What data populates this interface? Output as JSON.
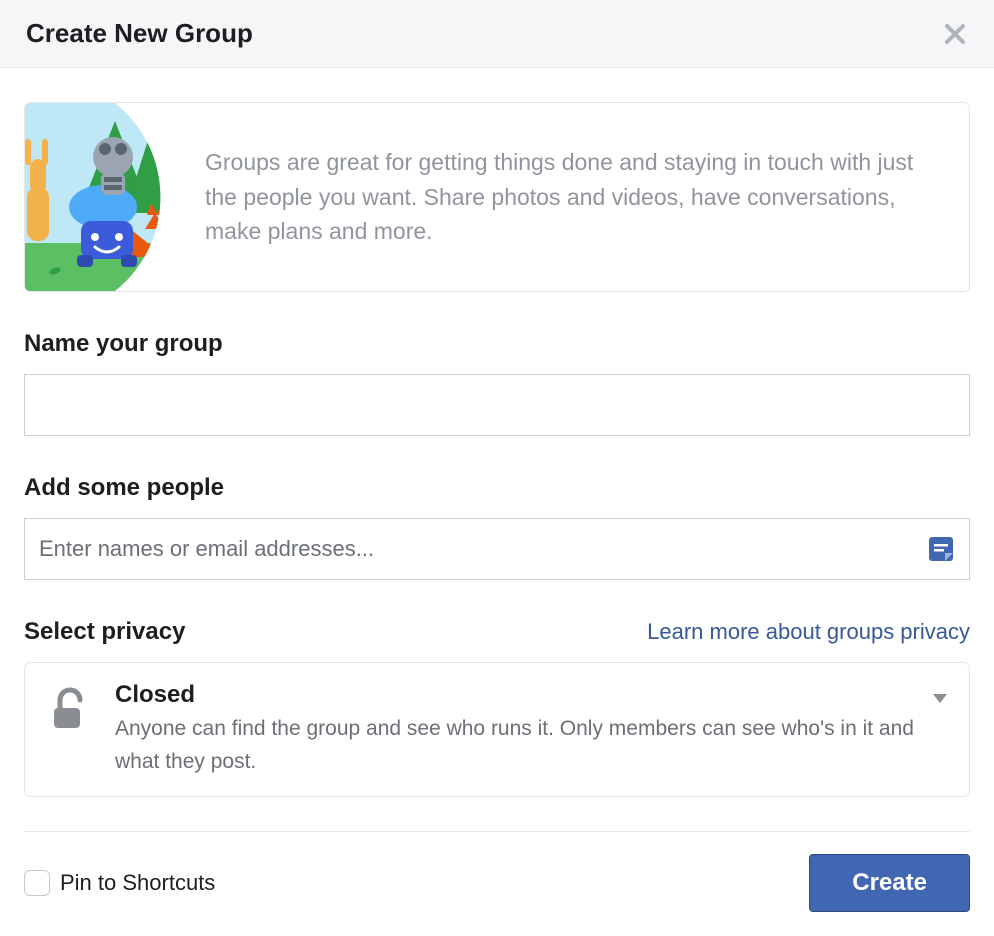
{
  "header": {
    "title": "Create New Group"
  },
  "intro": {
    "text": "Groups are great for getting things done and staying in touch with just the people you want. Share photos and videos, have conversations, make plans and more."
  },
  "name_section": {
    "label": "Name your group",
    "value": ""
  },
  "people_section": {
    "label": "Add some people",
    "placeholder": "Enter names or email addresses..."
  },
  "privacy_section": {
    "label": "Select privacy",
    "learn_more": "Learn more about groups privacy",
    "selected": {
      "title": "Closed",
      "description": "Anyone can find the group and see who runs it. Only members can see who's in it and what they post."
    }
  },
  "footer": {
    "pin_label": "Pin to Shortcuts",
    "pin_checked": false,
    "create_label": "Create"
  }
}
